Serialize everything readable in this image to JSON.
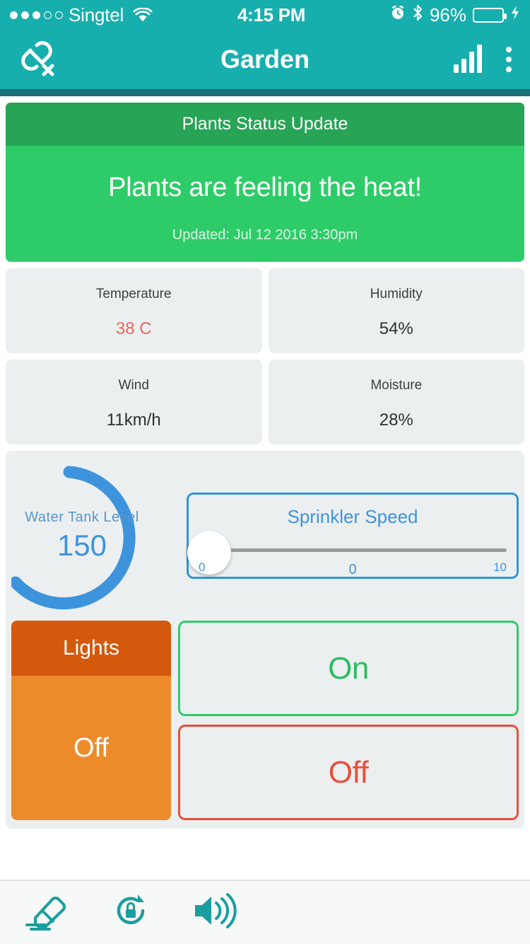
{
  "status_bar": {
    "carrier": "Singtel",
    "signal_dots_filled": 3,
    "signal_dots_total": 5,
    "wifi_icon": "wifi-icon",
    "time": "4:15 PM",
    "alarm_icon": "alarm-clock-icon",
    "bluetooth_icon": "bluetooth-icon",
    "battery_percent": "96%",
    "battery_level": 96,
    "battery_color": "#5ce070",
    "charging_icon": "lightning-bolt-icon"
  },
  "nav_bar": {
    "title": "Garden",
    "left_icon": "broken-link-icon",
    "signal_icon": "signal-bars-icon",
    "menu_icon": "overflow-menu-icon",
    "background_color": "#17aeae"
  },
  "status_card": {
    "header": "Plants Status Update",
    "message": "Plants are feeling the heat!",
    "updated": "Updated: Jul 12 2016 3:30pm",
    "header_color": "#27a456",
    "body_color": "#2ecc68"
  },
  "sensors": [
    {
      "label": "Temperature",
      "value": "38 C",
      "alert": true
    },
    {
      "label": "Humidity",
      "value": "54%",
      "alert": false
    },
    {
      "label": "Wind",
      "value": "11km/h",
      "alert": false
    },
    {
      "label": "Moisture",
      "value": "28%",
      "alert": false
    }
  ],
  "water_tank": {
    "label": "Water Tank Level",
    "value": "150",
    "accent_color": "#3d94dd"
  },
  "sprinkler": {
    "title": "Sprinkler Speed",
    "min": "0",
    "max": "10",
    "current": "0",
    "accent_color": "#2f95d8"
  },
  "lights": {
    "header": "Lights",
    "state": "Off",
    "header_color": "#d4590c",
    "body_color": "#ed8b2b"
  },
  "controls": {
    "on_label": "On",
    "off_label": "Off",
    "on_color": "#2ebd62",
    "off_color": "#e8503c"
  },
  "toolbar": {
    "items": [
      {
        "icon": "eraser-icon"
      },
      {
        "icon": "rotation-lock-icon"
      },
      {
        "icon": "volume-icon"
      }
    ],
    "icon_color": "#1a9e9e"
  }
}
